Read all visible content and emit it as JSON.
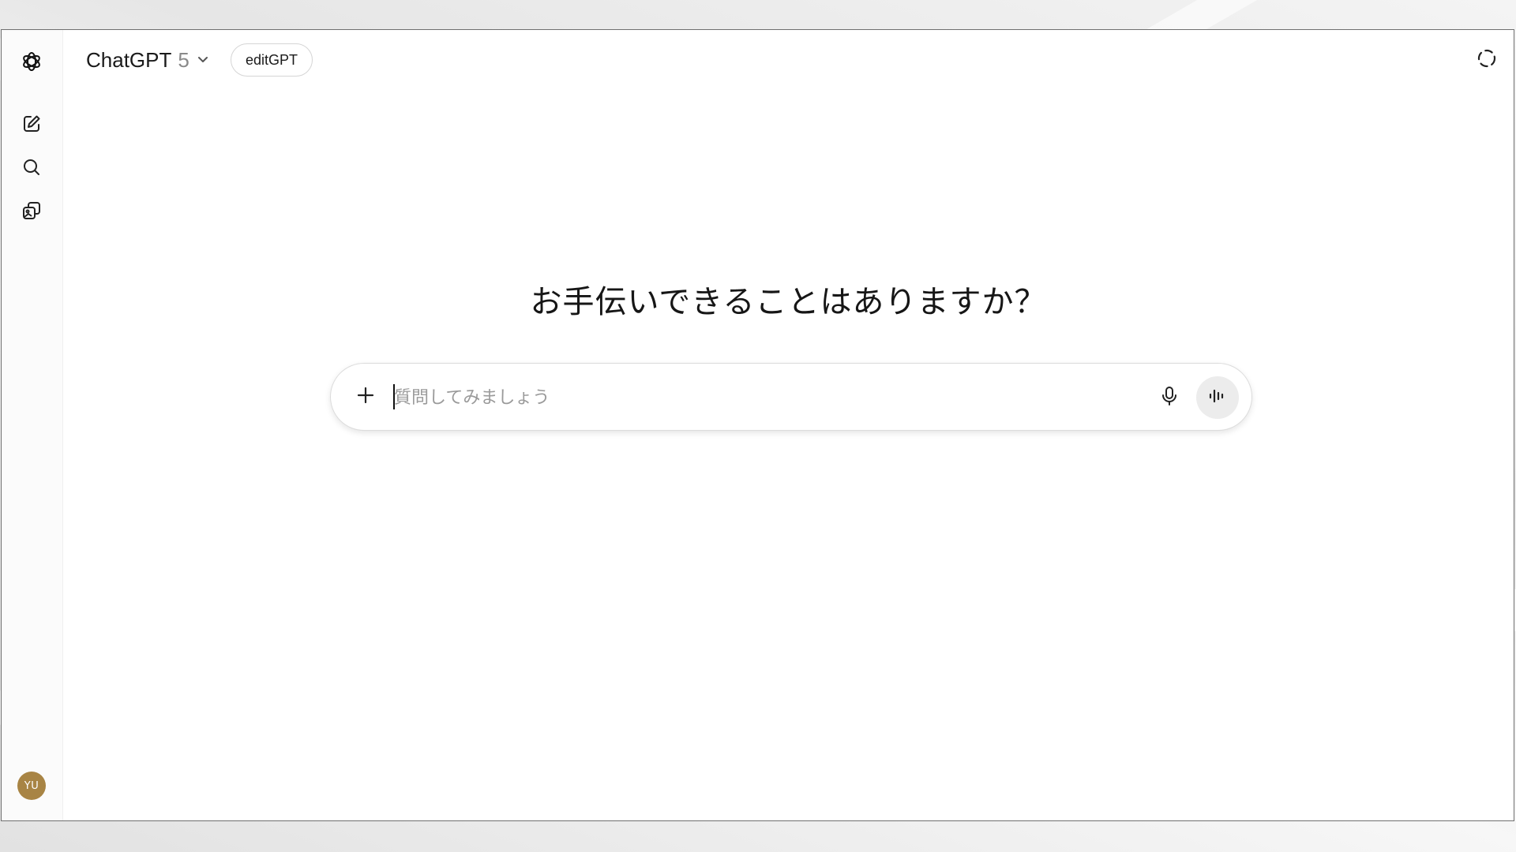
{
  "header": {
    "model_name": "ChatGPT",
    "model_version": "5",
    "edit_pill_label": "editGPT"
  },
  "sidebar": {
    "items": [
      {
        "icon": "new-chat-icon"
      },
      {
        "icon": "search-icon"
      },
      {
        "icon": "library-icon"
      }
    ],
    "avatar_initials": "YU",
    "avatar_color": "#a88444"
  },
  "main": {
    "headline": "お手伝いできることはありますか？",
    "composer": {
      "placeholder": "質問してみましょう",
      "value": ""
    }
  },
  "icons": {
    "logo": "openai-logo-icon",
    "model_dropdown": "chevron-down-icon",
    "temporary_chat": "dashed-circle-icon",
    "attach": "plus-icon",
    "dictate": "microphone-icon",
    "voice_mode": "voice-waveform-icon"
  }
}
